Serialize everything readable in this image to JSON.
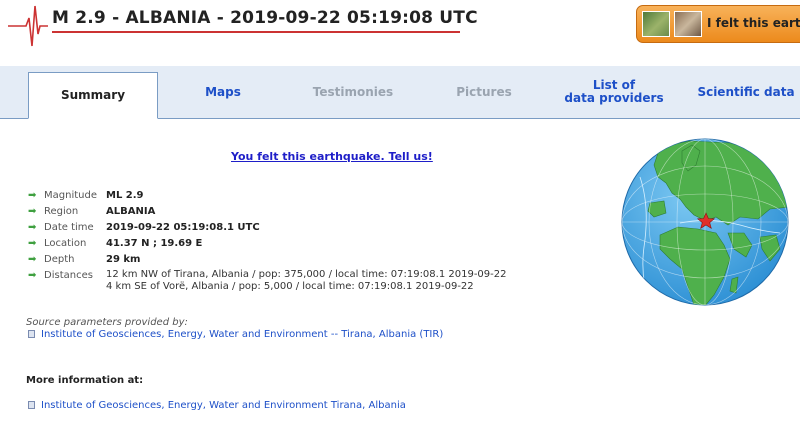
{
  "header": {
    "title": "M 2.9 - ALBANIA - 2019-09-22 05:19:08 UTC",
    "felt_button_label": "I felt this earthq"
  },
  "tabs": [
    {
      "label": "Summary",
      "state": "active"
    },
    {
      "label": "Maps",
      "state": "enabled"
    },
    {
      "label": "Testimonies",
      "state": "disabled"
    },
    {
      "label": "Pictures",
      "state": "disabled"
    },
    {
      "label": "List of data providers",
      "state": "enabled"
    },
    {
      "label": "Scientific data",
      "state": "enabled"
    }
  ],
  "felt_link": "You felt this earthquake. Tell us!",
  "details": {
    "magnitude": {
      "label": "Magnitude",
      "value": "ML 2.9"
    },
    "region": {
      "label": "Region",
      "value": "ALBANIA"
    },
    "datetime": {
      "label": "Date time",
      "value": "2019-09-22 05:19:08.1 UTC"
    },
    "location": {
      "label": "Location",
      "value": "41.37 N ; 19.69 E"
    },
    "depth": {
      "label": "Depth",
      "value": "29 km"
    },
    "distances": {
      "label": "Distances",
      "lines": [
        "12 km NW of Tirana, Albania / pop: 375,000 / local time: 07:19:08.1 2019-09-22",
        "4 km SE of Vorë, Albania / pop: 5,000 / local time: 07:19:08.1 2019-09-22"
      ]
    }
  },
  "source": {
    "label": "Source parameters provided by:",
    "link": "Institute of Geosciences, Energy, Water and Environment -- Tirana, Albania (TIR)"
  },
  "more_info": {
    "label": "More information at:",
    "link": "Institute of Geosciences, Energy, Water and Environment Tirana, Albania"
  },
  "colors": {
    "accent_link": "#1e50c8",
    "title_underline": "#cc3333",
    "felt_button": "#f0961e",
    "tab_bar": "#e4ecf6",
    "ocean": "#3aa0e0",
    "land": "#4fb04c",
    "epicenter_star": "#e0302a"
  },
  "icons": {
    "logo": "seismogram-icon",
    "bullet_arrow": "green-arrow-icon",
    "epicenter": "star-icon"
  }
}
